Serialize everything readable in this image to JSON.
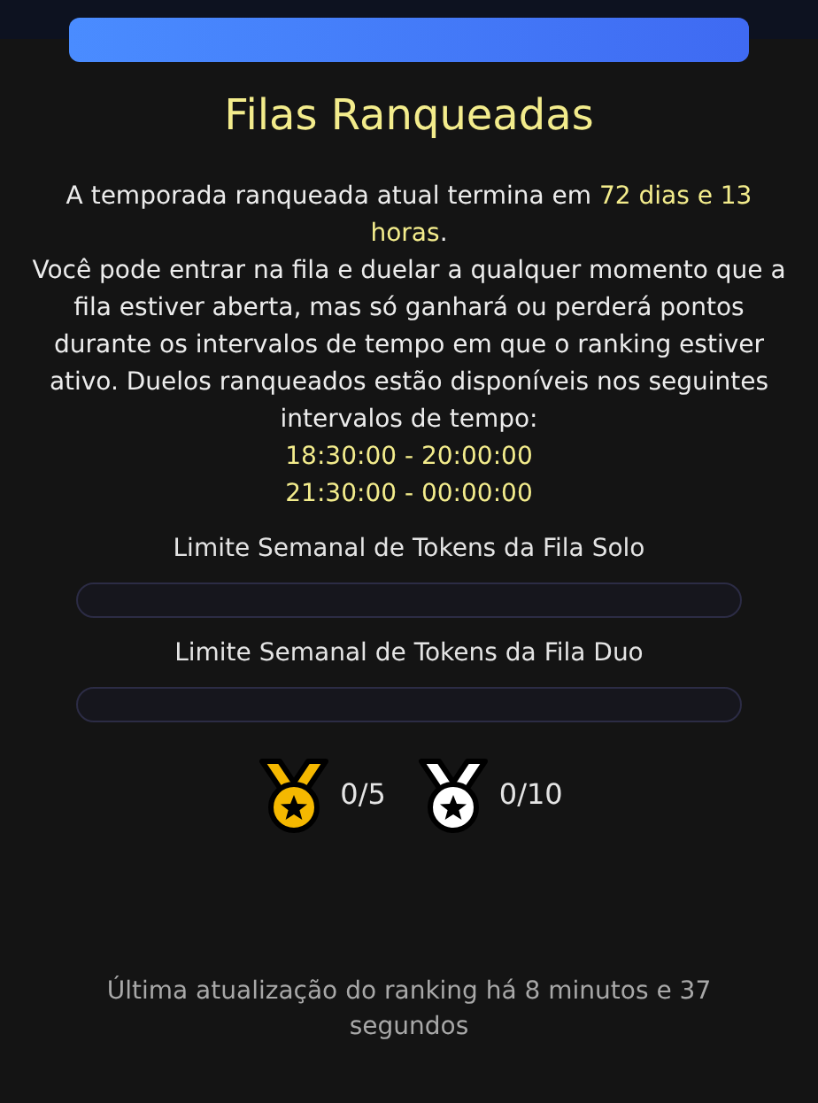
{
  "title": "Filas Ranqueadas",
  "season_note": [
    {
      "text": "A temporada ranqueada atual termina em ",
      "highlight": false
    },
    {
      "text": "72 dias e 13 horas",
      "highlight": true
    },
    {
      "text": ".",
      "highlight": false
    }
  ],
  "description": "Você pode entrar na fila e duelar a qualquer momento que a fila estiver aberta, mas só ganhará ou perderá pontos durante os intervalos de tempo em que o ranking estiver ativo. Duelos ranqueados estão disponíveis nos seguintes intervalos de tempo:",
  "intervals": [
    "18:30:00 - 20:00:00",
    "21:30:00 - 00:00:00"
  ],
  "token_limits": [
    {
      "label": "Limite Semanal de Tokens da Fila Solo",
      "level": 0
    },
    {
      "label": "Limite Semanal de Tokens da Fila Duo",
      "level": 0
    }
  ],
  "medals": [
    {
      "color": "#f5b800",
      "count": "0/5"
    },
    {
      "color": "#ffffff",
      "count": "0/10"
    }
  ],
  "last_update": "Última atualização do ranking há 8 minutos e 37 segundos"
}
